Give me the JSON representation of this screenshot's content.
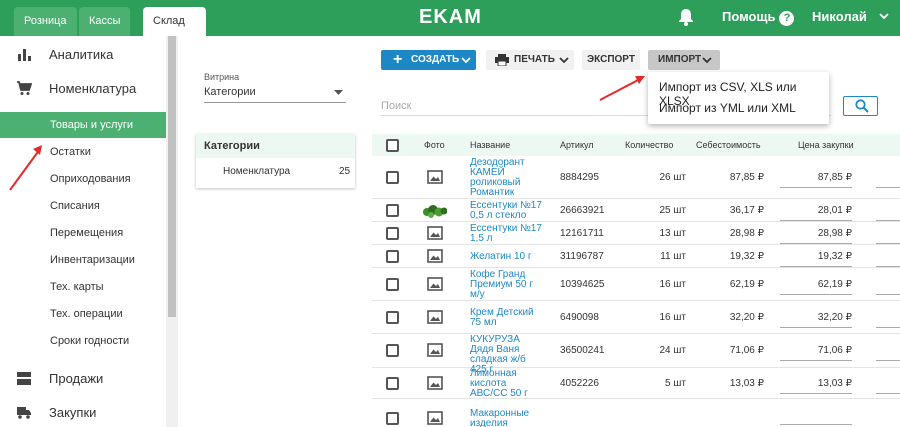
{
  "top_tabs": [
    "Розница",
    "Кассы",
    "Склад"
  ],
  "logo_text": "EKAM",
  "header": {
    "help": "Помощь",
    "help_icon": "?",
    "user": "Николай"
  },
  "sidebar": {
    "analytics": "Аналитика",
    "nomenclature": "Номенклатура",
    "items": [
      "Товары и услуги",
      "Остатки",
      "Оприходования",
      "Списания",
      "Перемещения",
      "Инвентаризации",
      "Тех. карты",
      "Тех. операции",
      "Сроки годности"
    ],
    "sales": "Продажи",
    "purchases": "Закупки"
  },
  "toolbar": {
    "create": "СОЗДАТЬ",
    "print": "ПЕЧАТЬ",
    "export": "ЭКСПОРТ",
    "import": "ИМПОРТ"
  },
  "import_menu": [
    "Импорт из CSV, XLS или XLSX",
    "Импорт из YML или XML"
  ],
  "vitrina": {
    "label": "Витрина",
    "value": "Категории"
  },
  "search": {
    "placeholder": "Поиск"
  },
  "categories": {
    "title": "Категории",
    "row_name": "Номенклатура",
    "row_count": "25"
  },
  "table": {
    "columns": [
      "Фото",
      "Название",
      "Артикул",
      "Количество",
      "Себестоимость",
      "Цена закупки"
    ],
    "rows": [
      {
        "name": [
          "Дезодорант",
          "КАМЕЙ",
          "роликовый",
          "Романтик"
        ],
        "sku": "8884295",
        "qty": "26 шт",
        "cost": "87,85 ₽",
        "price": "87,85 ₽",
        "photo": "placeholder"
      },
      {
        "name": [
          "Ессентуки №17",
          "0,5 л стекло"
        ],
        "sku": "26663921",
        "qty": "25 шт",
        "cost": "36,17 ₽",
        "price": "28,01 ₽",
        "photo": "greens"
      },
      {
        "name": [
          "Ессентуки №17",
          "1,5 л"
        ],
        "sku": "12161711",
        "qty": "13 шт",
        "cost": "28,98 ₽",
        "price": "28,98 ₽",
        "photo": "placeholder"
      },
      {
        "name": [
          "Желатин 10 г"
        ],
        "sku": "31196787",
        "qty": "11 шт",
        "cost": "19,32 ₽",
        "price": "19,32 ₽",
        "photo": "placeholder"
      },
      {
        "name": [
          "Кофе Гранд",
          "Премиум 50 г",
          "м/у"
        ],
        "sku": "10394625",
        "qty": "16 шт",
        "cost": "62,19 ₽",
        "price": "62,19 ₽",
        "photo": "placeholder"
      },
      {
        "name": [
          "Крем Детский",
          "75 мл"
        ],
        "sku": "6490098",
        "qty": "16 шт",
        "cost": "32,20 ₽",
        "price": "32,20 ₽",
        "photo": "placeholder"
      },
      {
        "name": [
          "КУКУРУЗА",
          "Дядя Ваня",
          "сладкая ж/б",
          "425 г"
        ],
        "sku": "36500241",
        "qty": "24 шт",
        "cost": "71,06 ₽",
        "price": "71,06 ₽",
        "photo": "placeholder"
      },
      {
        "name": [
          "Лимонная",
          "кислота",
          "АВС/СС 50 г"
        ],
        "sku": "4052226",
        "qty": "5 шт",
        "cost": "13,03 ₽",
        "price": "13,03 ₽",
        "photo": "placeholder"
      },
      {
        "name": [
          "Макаронные",
          "изделия"
        ],
        "sku": "",
        "qty": "",
        "cost": "",
        "price": "",
        "photo": "placeholder"
      }
    ]
  },
  "colors": {
    "brand_green": "#2e9e5b",
    "active_green": "#4cb073",
    "primary_blue": "#1e88c7",
    "arrow_red": "#e32b2b"
  }
}
